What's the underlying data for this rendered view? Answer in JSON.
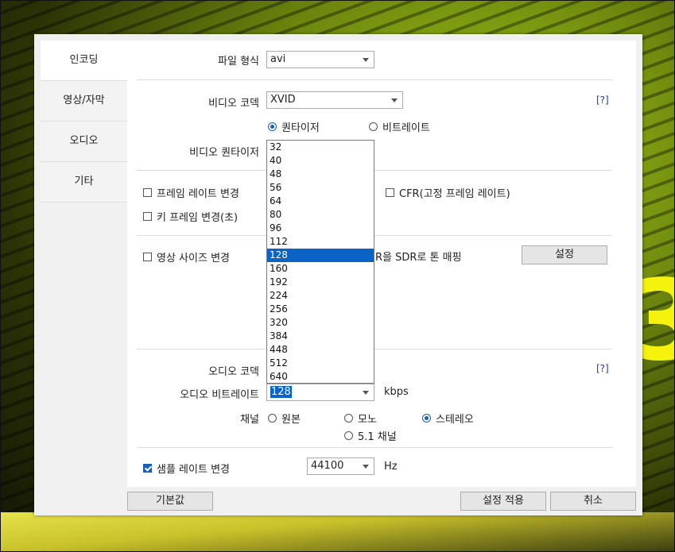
{
  "sidebar": {
    "tabs": [
      "인코딩",
      "영상/자막",
      "오디오",
      "기타"
    ]
  },
  "format": {
    "label": "파일 형식",
    "value": "avi"
  },
  "video": {
    "codec_label": "비디오 코덱",
    "codec_value": "XVID",
    "help": "[?]",
    "mode_quantizer": "퀀타이저",
    "mode_bitrate": "비트레이트",
    "quantizer_label": "비디오 퀀타이저",
    "quantizer_options": [
      "32",
      "40",
      "48",
      "56",
      "64",
      "80",
      "96",
      "112",
      "128",
      "160",
      "192",
      "224",
      "256",
      "320",
      "384",
      "448",
      "512",
      "640"
    ],
    "quantizer_selected": "128"
  },
  "framerate": {
    "change_label": "프레임 레이트 변경",
    "cfr_label": "CFR(고정 프레임 레이트)",
    "keyframe_label": "키 프레임 변경(초)"
  },
  "size": {
    "change_label": "영상 사이즈 변경",
    "tonemap_partial": "R을 SDR로 톤 매핑",
    "settings_button": "설정"
  },
  "audio": {
    "codec_label": "오디오 코덱",
    "help": "[?]",
    "bitrate_label": "오디오 비트레이트",
    "bitrate_value": "128",
    "bitrate_unit": "kbps",
    "channel_label": "채널",
    "ch_original": "원본",
    "ch_mono": "모노",
    "ch_stereo": "스테레오",
    "ch_51": "5.1 채널",
    "samplerate_label": "샘플 레이트 변경",
    "samplerate_value": "44100",
    "samplerate_unit": "Hz"
  },
  "footer": {
    "default_button": "기본값",
    "apply_button": "설정 적용",
    "cancel_button": "취소"
  }
}
